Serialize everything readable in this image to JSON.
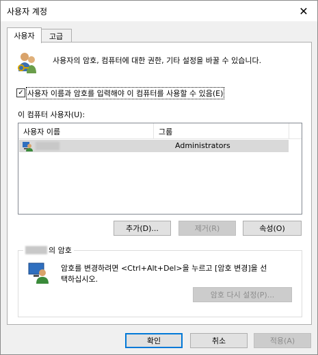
{
  "window": {
    "title": "사용자 계정",
    "close_glyph": "✕"
  },
  "tabs": [
    {
      "label": "사용자"
    },
    {
      "label": "고급"
    }
  ],
  "intro": {
    "text": "사용자의 암호, 컴퓨터에 대한 권한, 기타 설정을 바꿀 수 있습니다."
  },
  "require_login": {
    "label": "사용자 이름과 암호를 입력해야 이 컴퓨터를 사용할 수 있음(E)",
    "checked": true
  },
  "users_label": "이 컴퓨터 사용자(U):",
  "users_table": {
    "columns": [
      "사용자 이름",
      "그룹"
    ],
    "rows": [
      {
        "name": "",
        "group": "Administrators"
      }
    ]
  },
  "user_buttons": {
    "add": "추가(D)...",
    "remove": "제거(R)",
    "properties": "속성(O)"
  },
  "password_group": {
    "title_suffix": "의 암호",
    "text_line1": "암호를 변경하려면 <Ctrl+Alt+Del>을 누르고 [암호 변경]을 선",
    "text_line2": "택하십시오.",
    "reset_button": "암호 다시 설정(P)..."
  },
  "footer": {
    "ok": "확인",
    "cancel": "취소",
    "apply": "적용(A)"
  },
  "colors": {
    "selection": "#d9d9d9",
    "focus_border": "#0078d7",
    "panel": "#ffffff",
    "chrome": "#f0f0f0"
  }
}
